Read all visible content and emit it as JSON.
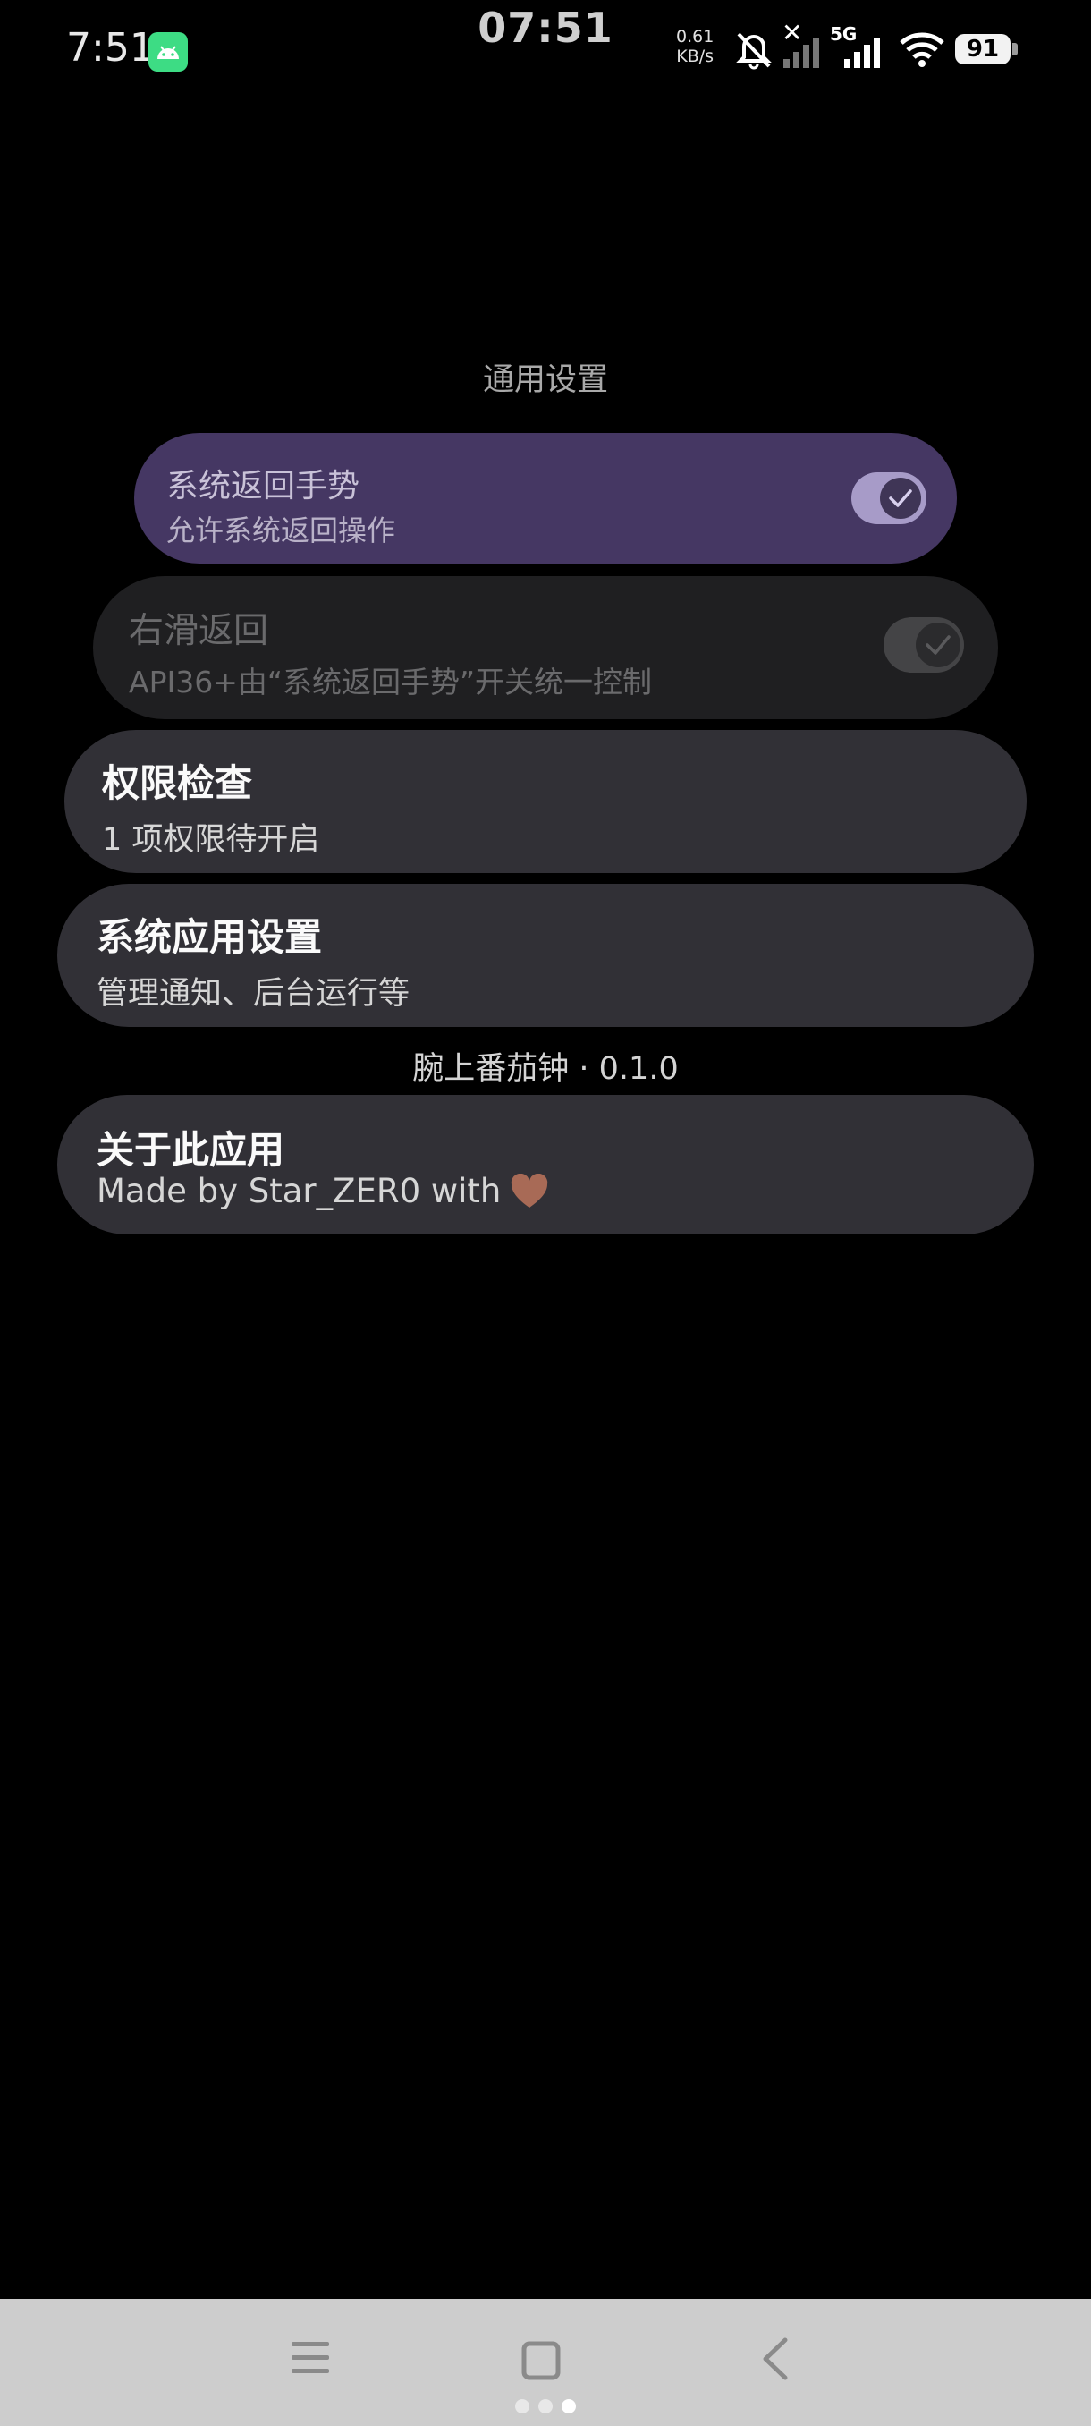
{
  "status_bar": {
    "time": "7:51",
    "clock": "07:51",
    "net_speed_value": "0.61",
    "net_speed_unit": "KB/s",
    "network": "5G",
    "battery": "91",
    "icons": [
      "android-app-icon",
      "bell-muted-icon",
      "signal-x-icon",
      "signal-5g-icon",
      "wifi-icon",
      "battery-icon"
    ]
  },
  "settings": {
    "section_title": "通用设置",
    "system_back": {
      "title": "系统返回手势",
      "subtitle": "允许系统返回操作",
      "enabled": true
    },
    "swipe_back": {
      "title": "右滑返回",
      "subtitle": "API36+由“系统返回手势”开关统一控制",
      "enabled": true,
      "disabled": true
    },
    "permission_check": {
      "title": "权限检查",
      "subtitle": "1 项权限待开启"
    },
    "system_app_settings": {
      "title": "系统应用设置",
      "subtitle": "管理通知、后台运行等"
    },
    "version_label": "腕上番茄钟 · 0.1.0",
    "about": {
      "title": "关于此应用",
      "subtitle": "Made by Star_ZER0 with",
      "emoji": "heart-icon"
    }
  },
  "colors": {
    "background": "#000000",
    "accent_card": "#453763",
    "card": "#313036",
    "disabled_card": "#1f1f21",
    "navbar": "#cdcdcd",
    "heart": "#a86a56"
  },
  "nav_bar": {
    "buttons": [
      "menu-icon",
      "home-icon",
      "back-icon"
    ],
    "page_count": 3,
    "active_page": 3
  }
}
